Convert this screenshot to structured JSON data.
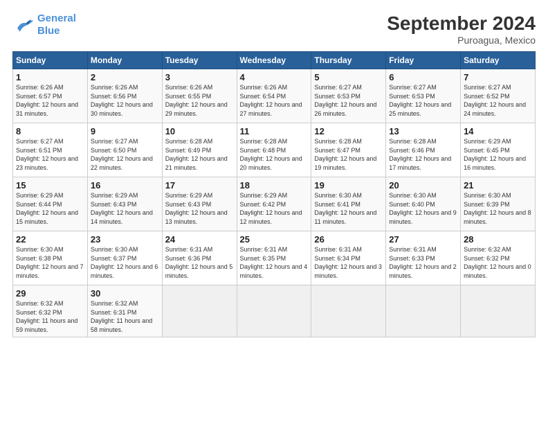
{
  "header": {
    "logo_line1": "General",
    "logo_line2": "Blue",
    "title": "September 2024",
    "location": "Puroagua, Mexico"
  },
  "weekdays": [
    "Sunday",
    "Monday",
    "Tuesday",
    "Wednesday",
    "Thursday",
    "Friday",
    "Saturday"
  ],
  "weeks": [
    [
      {
        "day": "1",
        "sunrise": "Sunrise: 6:26 AM",
        "sunset": "Sunset: 6:57 PM",
        "daylight": "Daylight: 12 hours and 31 minutes."
      },
      {
        "day": "2",
        "sunrise": "Sunrise: 6:26 AM",
        "sunset": "Sunset: 6:56 PM",
        "daylight": "Daylight: 12 hours and 30 minutes."
      },
      {
        "day": "3",
        "sunrise": "Sunrise: 6:26 AM",
        "sunset": "Sunset: 6:55 PM",
        "daylight": "Daylight: 12 hours and 29 minutes."
      },
      {
        "day": "4",
        "sunrise": "Sunrise: 6:26 AM",
        "sunset": "Sunset: 6:54 PM",
        "daylight": "Daylight: 12 hours and 27 minutes."
      },
      {
        "day": "5",
        "sunrise": "Sunrise: 6:27 AM",
        "sunset": "Sunset: 6:53 PM",
        "daylight": "Daylight: 12 hours and 26 minutes."
      },
      {
        "day": "6",
        "sunrise": "Sunrise: 6:27 AM",
        "sunset": "Sunset: 6:53 PM",
        "daylight": "Daylight: 12 hours and 25 minutes."
      },
      {
        "day": "7",
        "sunrise": "Sunrise: 6:27 AM",
        "sunset": "Sunset: 6:52 PM",
        "daylight": "Daylight: 12 hours and 24 minutes."
      }
    ],
    [
      {
        "day": "8",
        "sunrise": "Sunrise: 6:27 AM",
        "sunset": "Sunset: 6:51 PM",
        "daylight": "Daylight: 12 hours and 23 minutes."
      },
      {
        "day": "9",
        "sunrise": "Sunrise: 6:27 AM",
        "sunset": "Sunset: 6:50 PM",
        "daylight": "Daylight: 12 hours and 22 minutes."
      },
      {
        "day": "10",
        "sunrise": "Sunrise: 6:28 AM",
        "sunset": "Sunset: 6:49 PM",
        "daylight": "Daylight: 12 hours and 21 minutes."
      },
      {
        "day": "11",
        "sunrise": "Sunrise: 6:28 AM",
        "sunset": "Sunset: 6:48 PM",
        "daylight": "Daylight: 12 hours and 20 minutes."
      },
      {
        "day": "12",
        "sunrise": "Sunrise: 6:28 AM",
        "sunset": "Sunset: 6:47 PM",
        "daylight": "Daylight: 12 hours and 19 minutes."
      },
      {
        "day": "13",
        "sunrise": "Sunrise: 6:28 AM",
        "sunset": "Sunset: 6:46 PM",
        "daylight": "Daylight: 12 hours and 17 minutes."
      },
      {
        "day": "14",
        "sunrise": "Sunrise: 6:29 AM",
        "sunset": "Sunset: 6:45 PM",
        "daylight": "Daylight: 12 hours and 16 minutes."
      }
    ],
    [
      {
        "day": "15",
        "sunrise": "Sunrise: 6:29 AM",
        "sunset": "Sunset: 6:44 PM",
        "daylight": "Daylight: 12 hours and 15 minutes."
      },
      {
        "day": "16",
        "sunrise": "Sunrise: 6:29 AM",
        "sunset": "Sunset: 6:43 PM",
        "daylight": "Daylight: 12 hours and 14 minutes."
      },
      {
        "day": "17",
        "sunrise": "Sunrise: 6:29 AM",
        "sunset": "Sunset: 6:43 PM",
        "daylight": "Daylight: 12 hours and 13 minutes."
      },
      {
        "day": "18",
        "sunrise": "Sunrise: 6:29 AM",
        "sunset": "Sunset: 6:42 PM",
        "daylight": "Daylight: 12 hours and 12 minutes."
      },
      {
        "day": "19",
        "sunrise": "Sunrise: 6:30 AM",
        "sunset": "Sunset: 6:41 PM",
        "daylight": "Daylight: 12 hours and 11 minutes."
      },
      {
        "day": "20",
        "sunrise": "Sunrise: 6:30 AM",
        "sunset": "Sunset: 6:40 PM",
        "daylight": "Daylight: 12 hours and 9 minutes."
      },
      {
        "day": "21",
        "sunrise": "Sunrise: 6:30 AM",
        "sunset": "Sunset: 6:39 PM",
        "daylight": "Daylight: 12 hours and 8 minutes."
      }
    ],
    [
      {
        "day": "22",
        "sunrise": "Sunrise: 6:30 AM",
        "sunset": "Sunset: 6:38 PM",
        "daylight": "Daylight: 12 hours and 7 minutes."
      },
      {
        "day": "23",
        "sunrise": "Sunrise: 6:30 AM",
        "sunset": "Sunset: 6:37 PM",
        "daylight": "Daylight: 12 hours and 6 minutes."
      },
      {
        "day": "24",
        "sunrise": "Sunrise: 6:31 AM",
        "sunset": "Sunset: 6:36 PM",
        "daylight": "Daylight: 12 hours and 5 minutes."
      },
      {
        "day": "25",
        "sunrise": "Sunrise: 6:31 AM",
        "sunset": "Sunset: 6:35 PM",
        "daylight": "Daylight: 12 hours and 4 minutes."
      },
      {
        "day": "26",
        "sunrise": "Sunrise: 6:31 AM",
        "sunset": "Sunset: 6:34 PM",
        "daylight": "Daylight: 12 hours and 3 minutes."
      },
      {
        "day": "27",
        "sunrise": "Sunrise: 6:31 AM",
        "sunset": "Sunset: 6:33 PM",
        "daylight": "Daylight: 12 hours and 2 minutes."
      },
      {
        "day": "28",
        "sunrise": "Sunrise: 6:32 AM",
        "sunset": "Sunset: 6:32 PM",
        "daylight": "Daylight: 12 hours and 0 minutes."
      }
    ],
    [
      {
        "day": "29",
        "sunrise": "Sunrise: 6:32 AM",
        "sunset": "Sunset: 6:32 PM",
        "daylight": "Daylight: 11 hours and 59 minutes."
      },
      {
        "day": "30",
        "sunrise": "Sunrise: 6:32 AM",
        "sunset": "Sunset: 6:31 PM",
        "daylight": "Daylight: 11 hours and 58 minutes."
      },
      null,
      null,
      null,
      null,
      null
    ]
  ]
}
